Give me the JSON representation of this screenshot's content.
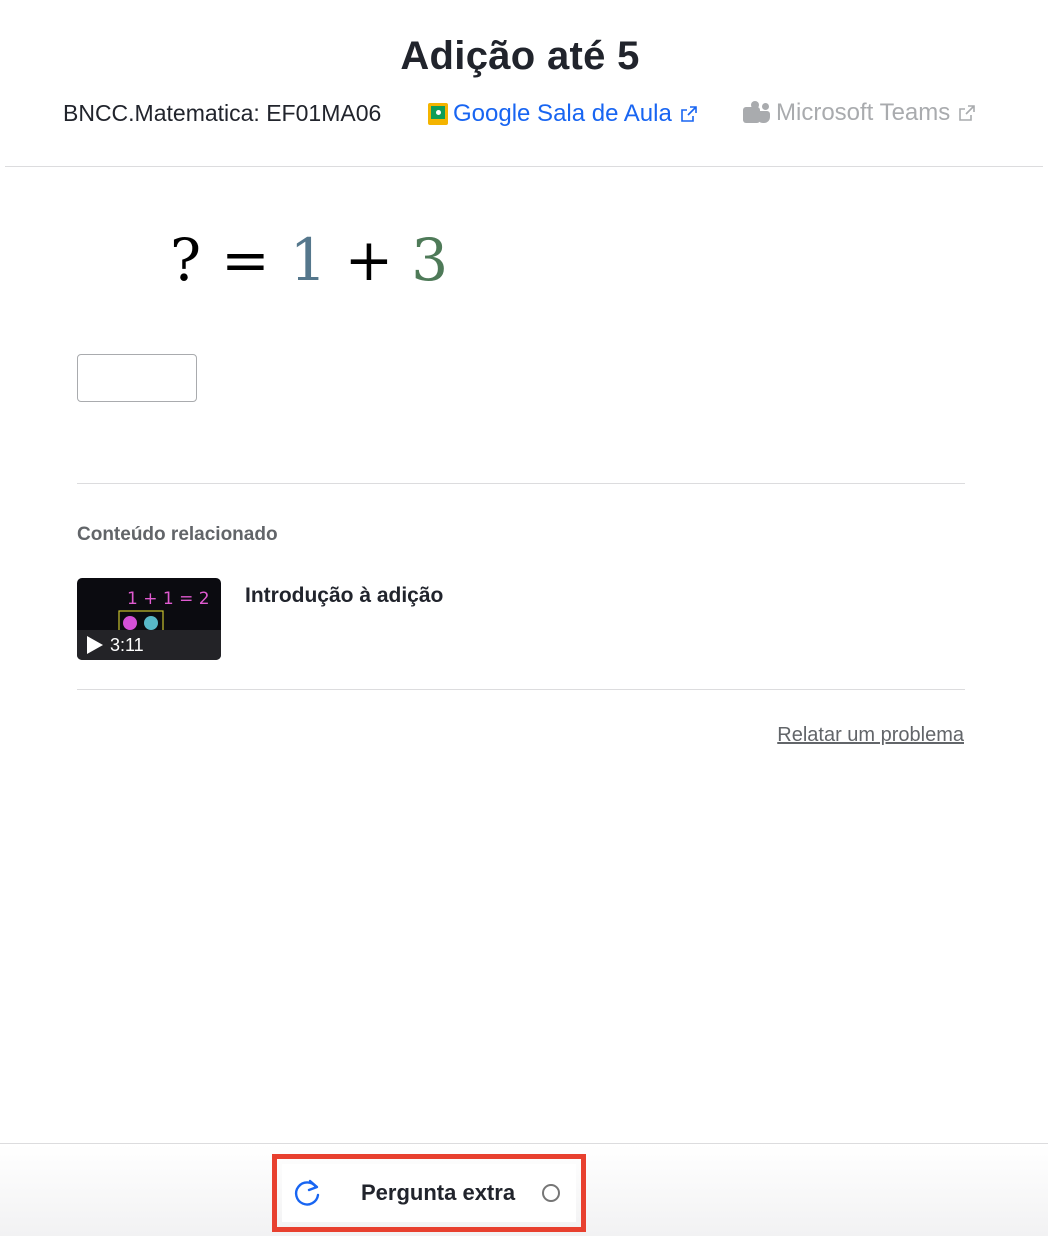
{
  "header": {
    "title": "Adição até 5",
    "standard": "BNCC.Matematica: EF01MA06",
    "classroom_label": "Google Sala de Aula",
    "teams_label": "Microsoft Teams"
  },
  "exercise": {
    "unknown": "?",
    "equals": "=",
    "operand_a": "1",
    "operator": "+",
    "operand_b": "3",
    "operand_a_color": "#55778c",
    "operand_b_color": "#4e7a58",
    "answer_value": ""
  },
  "related": {
    "heading": "Conteúdo relacionado",
    "items": [
      {
        "title": "Introdução à adição",
        "duration": "3:11",
        "thumb_text": "1 + 1 = 2"
      }
    ]
  },
  "report_link": "Relatar um problema",
  "footer": {
    "extra_label": "Pergunta extra",
    "refresh_icon": "refresh-icon",
    "status_icon": "empty-circle-icon",
    "highlight_color": "#e8402f",
    "accent_color": "#1865f2"
  }
}
